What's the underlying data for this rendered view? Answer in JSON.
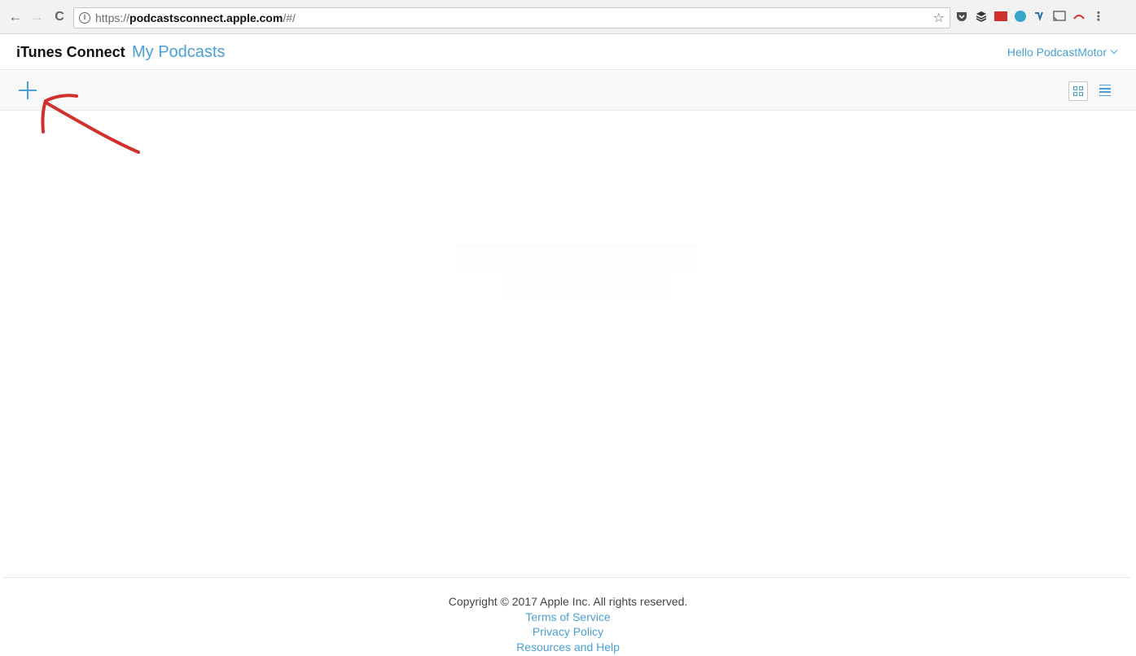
{
  "browser": {
    "url_scheme": "https://",
    "url_host": "podcastsconnect.apple.com",
    "url_path": "/#/",
    "extensions": [
      "pocket-icon",
      "buffer-icon",
      "red-extension-icon",
      "teal-extension-icon",
      "vimeo-icon",
      "cast-icon",
      "wave-extension-icon"
    ]
  },
  "header": {
    "brand": "iTunes Connect",
    "section": "My Podcasts",
    "user_greeting": "Hello PodcastMotor"
  },
  "toolbar": {
    "add_icon": "plus-icon",
    "grid_view_icon": "grid-view-icon",
    "list_view_icon": "list-view-icon"
  },
  "annotation": {
    "color": "#d0312d"
  },
  "footer": {
    "copyright": "Copyright © 2017 Apple Inc. All rights reserved.",
    "links": [
      "Terms of Service",
      "Privacy Policy",
      "Resources and Help"
    ]
  },
  "colors": {
    "accent": "#4a9fd8"
  }
}
